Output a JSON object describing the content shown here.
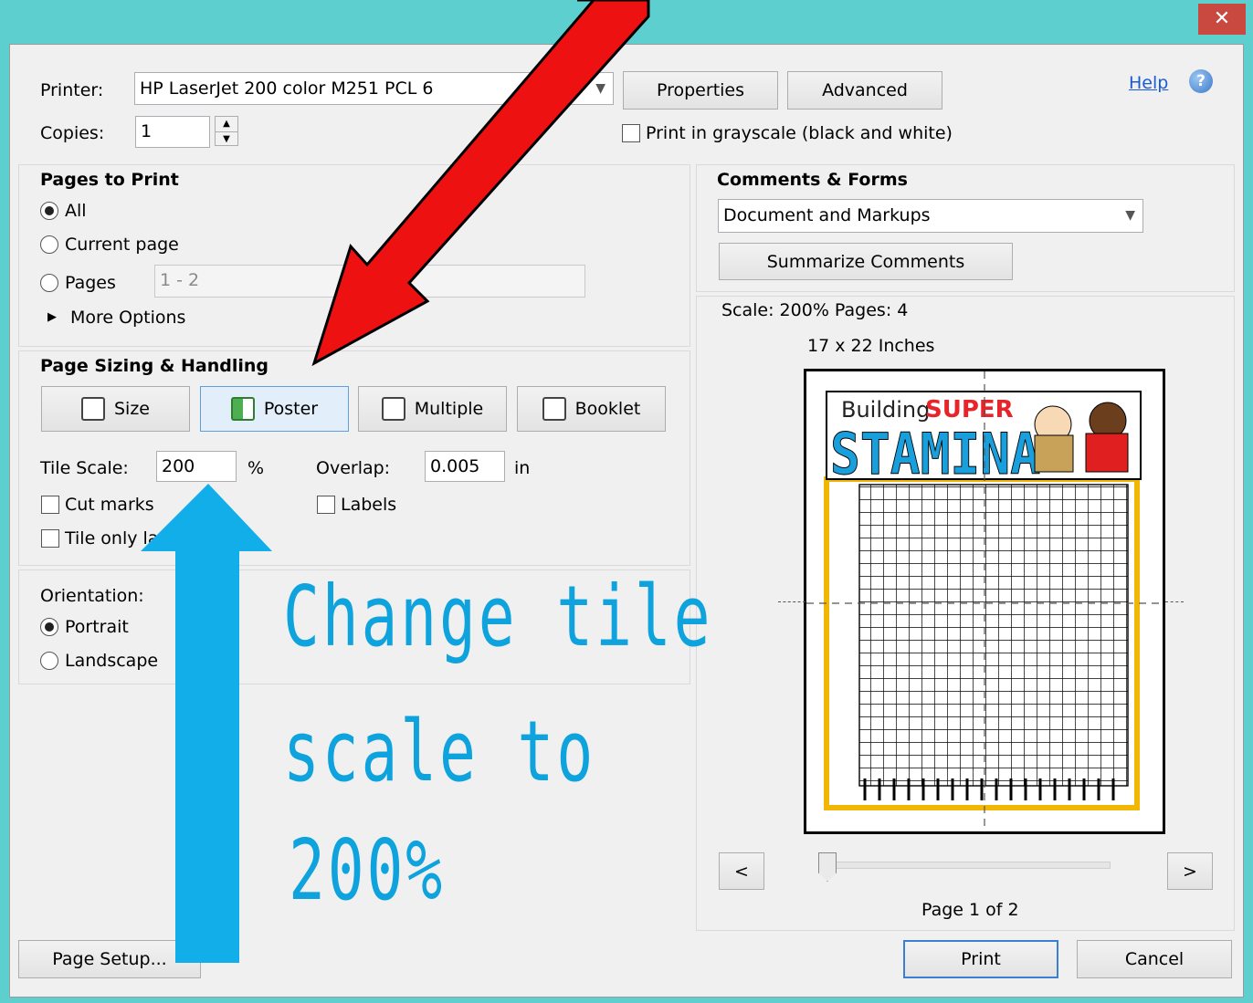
{
  "window": {
    "close_label": "✕"
  },
  "header": {
    "printer_label": "Printer:",
    "printer_value": "HP LaserJet 200 color M251 PCL 6",
    "copies_label": "Copies:",
    "copies_value": "1",
    "properties_button": "Properties",
    "advanced_button": "Advanced",
    "grayscale_label": "Print in grayscale (black and white)",
    "grayscale_checked": false,
    "help_link": "Help",
    "help_icon": "?"
  },
  "pages_to_print": {
    "title": "Pages to Print",
    "all_label": "All",
    "current_label": "Current page",
    "pages_label": "Pages",
    "pages_value": "1 - 2",
    "more_options": "More Options",
    "selected": "All"
  },
  "page_sizing": {
    "title": "Page Sizing & Handling",
    "size_button": "Size",
    "poster_button": "Poster",
    "multiple_button": "Multiple",
    "booklet_button": "Booklet",
    "selected_mode": "Poster",
    "tile_scale_label": "Tile Scale:",
    "tile_scale_value": "200",
    "tile_scale_unit": "%",
    "overlap_label": "Overlap:",
    "overlap_value": "0.005",
    "overlap_unit": "in",
    "cut_marks_label": "Cut marks",
    "labels_label": "Labels",
    "tile_only_label": "Tile only la"
  },
  "orientation": {
    "title": "Orientation:",
    "portrait_label": "Portrait",
    "landscape_label": "Landscape",
    "selected": "Portrait"
  },
  "comments_forms": {
    "title": "Comments & Forms",
    "select_value": "Document and Markups",
    "summarize_button": "Summarize Comments"
  },
  "preview": {
    "scale_text": "Scale: 200% Pages: 4",
    "size_text": "17 x 22 Inches",
    "prev_button": "<",
    "next_button": ">",
    "page_indicator": "Page 1 of 2",
    "slider_level": 0,
    "doc_title_part1": "Building",
    "doc_title_part2": "SUPER",
    "doc_title_big": "STAMINA"
  },
  "footer": {
    "page_setup_button": "Page Setup...",
    "print_button": "Print",
    "cancel_button": "Cancel"
  },
  "annotation": {
    "line1": "Change tile",
    "line2": "scale to",
    "line3": "200%",
    "red_arrow_color": "#EE1111",
    "blue_arrow_color": "#12AEEA",
    "text_color": "#0EA3DD"
  }
}
